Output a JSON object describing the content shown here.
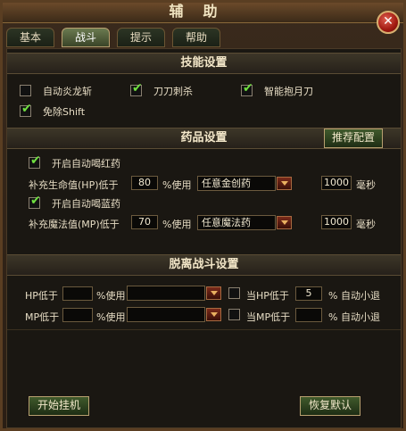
{
  "window": {
    "title": "辅助"
  },
  "tabs": [
    {
      "label": "基本"
    },
    {
      "label": "战斗",
      "active": true
    },
    {
      "label": "提示"
    },
    {
      "label": "帮助"
    }
  ],
  "skills": {
    "header": "技能设置",
    "options": [
      {
        "label": "自动炎龙斩",
        "checked": false
      },
      {
        "label": "刀刀刺杀",
        "checked": true
      },
      {
        "label": "智能抱月刀",
        "checked": true
      },
      {
        "label": "免除Shift",
        "checked": true
      }
    ]
  },
  "potions": {
    "header": "药品设置",
    "recommend_button": "推荐配置",
    "red": {
      "enable_label": "开启自动喝红药",
      "enabled": true,
      "threshold_label": "补充生命值(HP)低于",
      "threshold_value": "80",
      "unit_label": "%使用",
      "item": "任意金创药",
      "ms_value": "1000",
      "ms_label": "毫秒"
    },
    "blue": {
      "enable_label": "开启自动喝蓝药",
      "enabled": true,
      "threshold_label": "补充魔法值(MP)低于",
      "threshold_value": "70",
      "unit_label": "%使用",
      "item": "任意魔法药",
      "ms_value": "1000",
      "ms_label": "毫秒"
    }
  },
  "escape": {
    "header": "脱离战斗设置",
    "hp": {
      "label": "HP低于",
      "value": "",
      "unit_label": "%使用",
      "item": "",
      "checked": false,
      "when_label": "当HP低于",
      "when_value": "5",
      "action_label": "% 自动小退"
    },
    "mp": {
      "label": "MP低于",
      "value": "",
      "unit_label": "%使用",
      "item": "",
      "checked": false,
      "when_label": "当MP低于",
      "when_value": "",
      "action_label": "% 自动小退"
    }
  },
  "footer": {
    "start_button": "开始挂机",
    "restore_button": "恢复默认"
  },
  "icons": {
    "close": "close-icon",
    "check": "check-icon",
    "dropdown": "chevron-down-icon"
  }
}
